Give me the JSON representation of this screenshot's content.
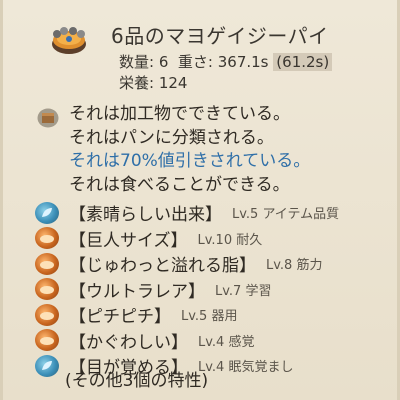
{
  "item": {
    "icon": "pie-icon",
    "title": "6品のマヨゲイジーパイ",
    "quantity_label": "数量: 6",
    "weight_label": "重さ: 367.1s",
    "weight_total": "(61.2s)",
    "nutrition_label": "栄養: 124"
  },
  "description": {
    "icon": "package-icon",
    "lines": [
      "それは加工物でできている。",
      "それはパンに分類される。",
      "それは70%値引きされている。",
      "それは食べることができる。"
    ]
  },
  "traits": [
    {
      "icon": "leaf-icon",
      "color": "#3b8fb8",
      "name": "【素晴らしい出来】",
      "level": "Lv.5 アイテム品質"
    },
    {
      "icon": "bread-icon",
      "color": "#c9661f",
      "name": "【巨人サイズ】",
      "level": "Lv.10 耐久"
    },
    {
      "icon": "bread-icon",
      "color": "#c9661f",
      "name": "【じゅわっと溢れる脂】",
      "level": "Lv.8 筋力"
    },
    {
      "icon": "bread-icon",
      "color": "#c9661f",
      "name": "【ウルトラレア】",
      "level": "Lv.7 学習"
    },
    {
      "icon": "bread-icon",
      "color": "#c9661f",
      "name": "【ピチピチ】",
      "level": "Lv.5 器用"
    },
    {
      "icon": "bread-icon",
      "color": "#c9661f",
      "name": "【かぐわしい】",
      "level": "Lv.4 感覚"
    },
    {
      "icon": "leaf-icon",
      "color": "#3b8fb8",
      "name": "【目が覚める】",
      "level": "Lv.4 眠気覚まし"
    }
  ],
  "more_traits": "(その他3個の特性)",
  "colors": {
    "background": "#ebe3d1",
    "discount_text": "#2f6fa8",
    "quality_icon": "#3b8fb8",
    "food_icon": "#c9661f"
  }
}
